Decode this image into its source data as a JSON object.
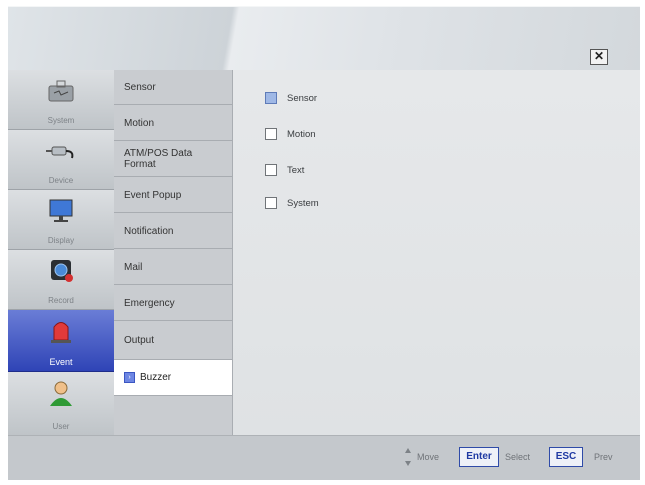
{
  "titlebar": {
    "close_glyph": "✕"
  },
  "nav": {
    "items": [
      {
        "label": "System",
        "icon": "toolbox-icon"
      },
      {
        "label": "Device",
        "icon": "plug-icon"
      },
      {
        "label": "Display",
        "icon": "monitor-icon"
      },
      {
        "label": "Record",
        "icon": "camera-record-icon"
      },
      {
        "label": "Event",
        "icon": "alarm-light-icon",
        "active": true
      },
      {
        "label": "User",
        "icon": "user-icon"
      }
    ]
  },
  "submenu": {
    "items": [
      {
        "label": "Sensor"
      },
      {
        "label": "Motion"
      },
      {
        "label": "ATM/POS Data Format"
      },
      {
        "label": "Event Popup"
      },
      {
        "label": "Notification"
      },
      {
        "label": "Mail"
      },
      {
        "label": "Emergency"
      },
      {
        "label": "Output"
      },
      {
        "label": "Buzzer",
        "active": true
      }
    ]
  },
  "content": {
    "options": [
      {
        "label": "Sensor",
        "checked": true
      },
      {
        "label": "Motion",
        "checked": false
      },
      {
        "label": "Text",
        "checked": false
      },
      {
        "label": "System",
        "checked": false
      }
    ]
  },
  "footer": {
    "move": "Move",
    "enter_key": "Enter",
    "select": "Select",
    "esc_key": "ESC",
    "prev": "Prev"
  },
  "colors": {
    "active_nav": "#3a4fc0",
    "checkbox_checked": "#9fb8e6"
  }
}
